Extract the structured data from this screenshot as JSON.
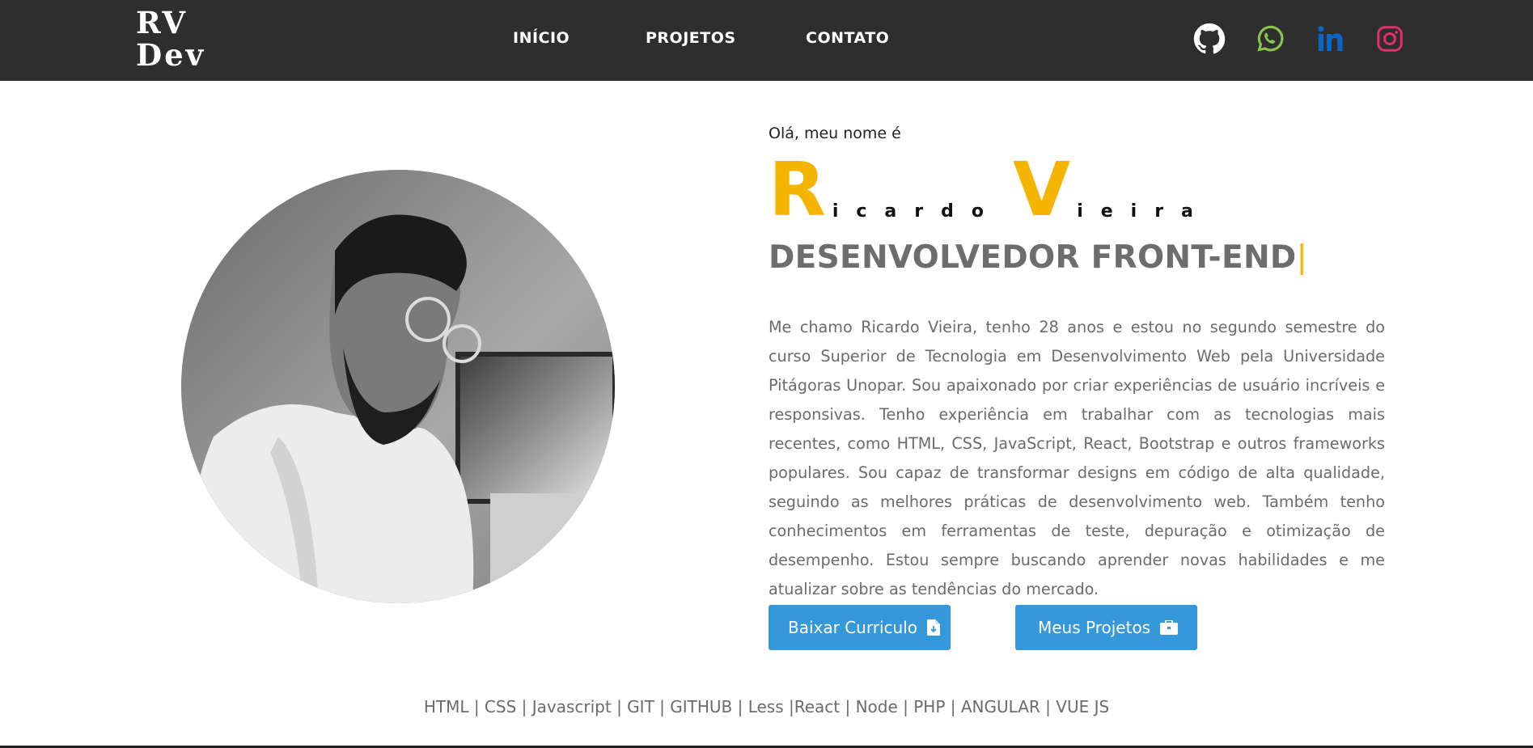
{
  "logo": {
    "line1": "RV",
    "line2": "Dev"
  },
  "nav": {
    "home": "INÍCIO",
    "projects": "PROJETOS",
    "contact": "CONTATO"
  },
  "social": [
    {
      "icon": "github-icon",
      "color": "#ffffff"
    },
    {
      "icon": "whatsapp-icon",
      "color": "#8bc34a"
    },
    {
      "icon": "linkedin-icon",
      "color": "#0a66c2"
    },
    {
      "icon": "instagram-icon",
      "color": "#e1306c"
    }
  ],
  "hero": {
    "greeting": "Olá, meu nome é",
    "first_initial": "R",
    "first_rest": "icardo",
    "last_initial": "V",
    "last_rest": "ieira",
    "role": "DESENVOLVEDOR FRONT-END",
    "caret": "|",
    "about": "Me chamo Ricardo Vieira, tenho 28 anos e estou no segundo semestre do curso Superior de Tecnologia em Desenvolvimento Web pela Universidade Pitágoras Unopar. Sou apaixonado por criar experiências de usuário incríveis e responsivas. Tenho experiência em trabalhar com as tecnologias mais recentes, como HTML, CSS, JavaScript, React, Bootstrap e outros frameworks populares. Sou capaz de transformar designs em código de alta qualidade, seguindo as melhores práticas de desenvolvimento web. Também tenho conhecimentos em ferramentas de teste, depuração e otimização de desempenho. Estou sempre buscando aprender novas habilidades e me atualizar sobre as tendências do mercado."
  },
  "buttons": {
    "cv": "Baixar Curriculo",
    "projects": "Meus Projetos"
  },
  "skills": "HTML | CSS | Javascript | GIT | GITHUB | Less |React | Node | PHP | ANGULAR | VUE JS",
  "colors": {
    "accent": "#f5b400",
    "header": "#2e2e2e",
    "button": "#3498db"
  }
}
